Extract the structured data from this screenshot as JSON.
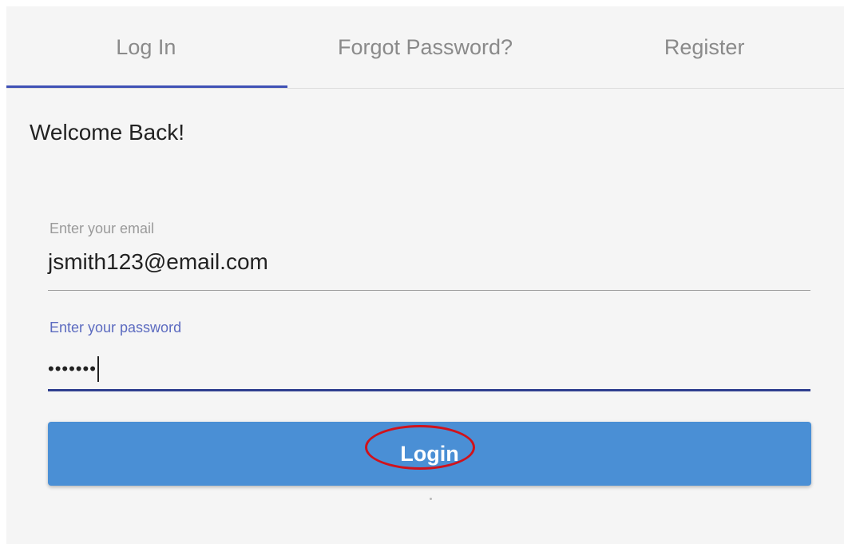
{
  "tabs": [
    {
      "label": "Log In",
      "active": true
    },
    {
      "label": "Forgot Password?",
      "active": false
    },
    {
      "label": "Register",
      "active": false
    }
  ],
  "welcome_text": "Welcome Back!",
  "email_field": {
    "label": "Enter your email",
    "value": "jsmith123@email.com"
  },
  "password_field": {
    "label": "Enter your password",
    "masked_value": "•••••••",
    "focused": true
  },
  "login_button": {
    "label": "Login"
  },
  "colors": {
    "accent": "#3f51b5",
    "button": "#4a8fd5",
    "annotation": "#d0121b"
  }
}
